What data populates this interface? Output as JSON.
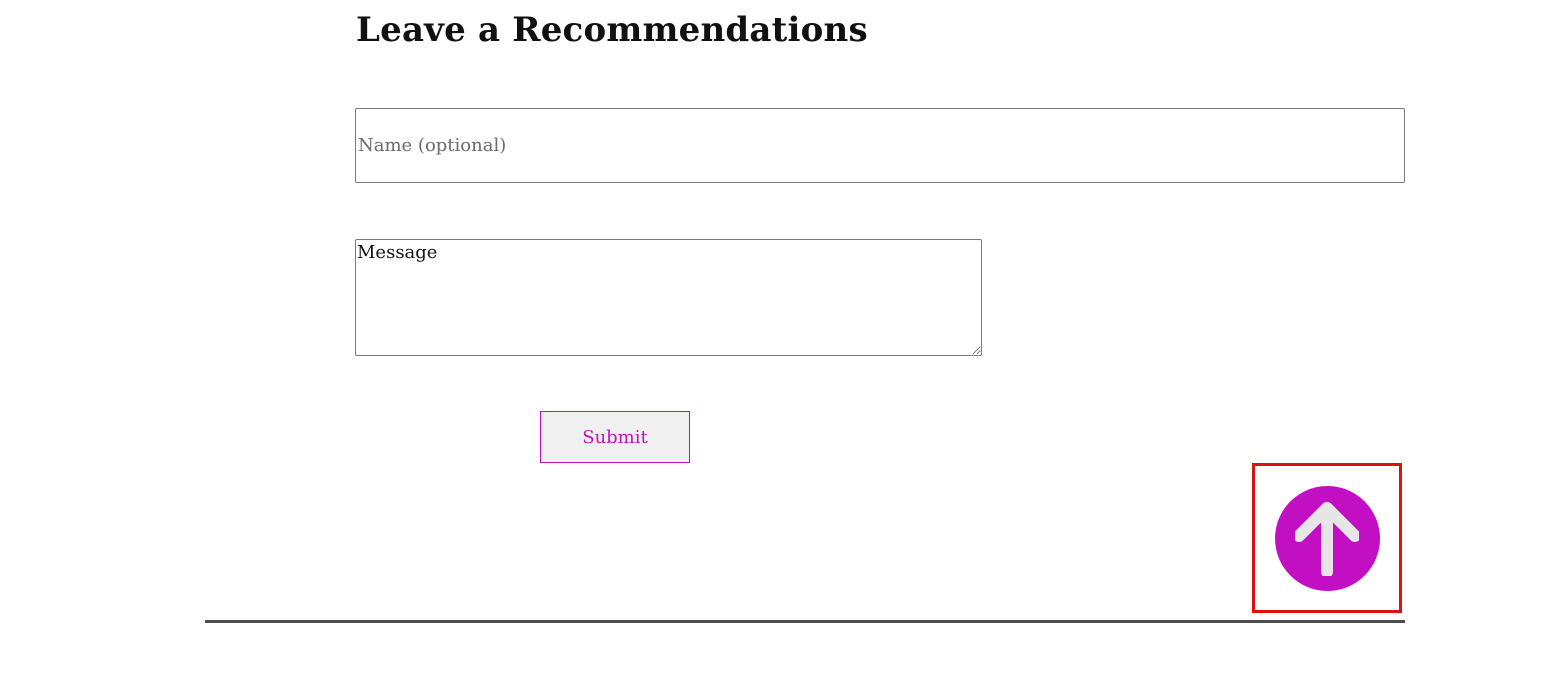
{
  "form": {
    "heading": "Leave a Recommendations",
    "name_placeholder": "Name (optional)",
    "name_value": "",
    "message_placeholder": "Message",
    "message_value": "",
    "submit_label": "Submit"
  },
  "back_to_top": {
    "icon": "arrow-up-icon",
    "circle_color": "#c30fc3",
    "arrow_color": "#e6e6e6",
    "highlight_color": "#e01010"
  },
  "colors": {
    "accent": "#c311c3",
    "button_bg": "#f0f0f0",
    "heading": "#111111",
    "rule": "#4d4d4d"
  }
}
